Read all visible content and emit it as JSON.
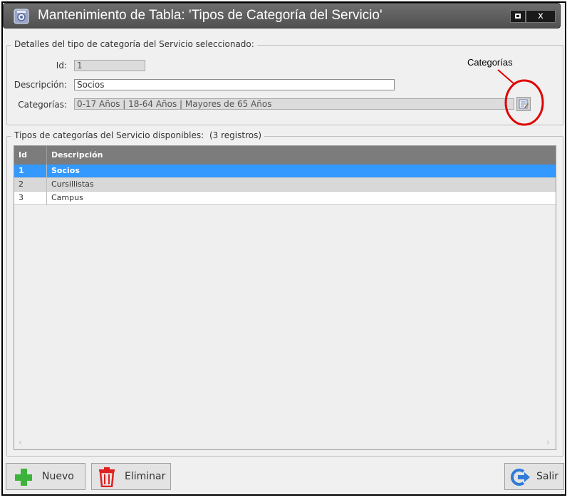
{
  "window": {
    "title": "Mantenimiento de Tabla: 'Tipos de Categoría del Servicio'",
    "close_symbol": "x",
    "icon": "settings-app-icon"
  },
  "details": {
    "legend": "Detalles del tipo de categoría del Servicio seleccionado:",
    "id_label": "Id:",
    "id_value": "1",
    "desc_label": "Descripción:",
    "desc_value": "Socios",
    "cat_label": "Categorías:",
    "cat_value": "0-17 Años | 18-64 Años | Mayores de 65 Años",
    "cat_button_icon": "edit-list-icon"
  },
  "annotation": {
    "text": "Categorías",
    "color": "#e00000"
  },
  "list": {
    "legend": "Tipos de categorías del Servicio disponibles:",
    "count": "(3 registros)",
    "columns": [
      "Id",
      "Descripción"
    ],
    "rows": [
      {
        "id": "1",
        "desc": "Socios",
        "selected": true
      },
      {
        "id": "2",
        "desc": "Cursillistas",
        "selected": false
      },
      {
        "id": "3",
        "desc": "Campus",
        "selected": false
      }
    ],
    "selected_color": "#3399ff"
  },
  "buttons": {
    "new": {
      "label": "Nuevo",
      "icon": "plus-icon"
    },
    "delete": {
      "label": "Eliminar",
      "icon": "trash-icon"
    },
    "exit": {
      "label": "Salir",
      "icon": "exit-icon"
    }
  }
}
